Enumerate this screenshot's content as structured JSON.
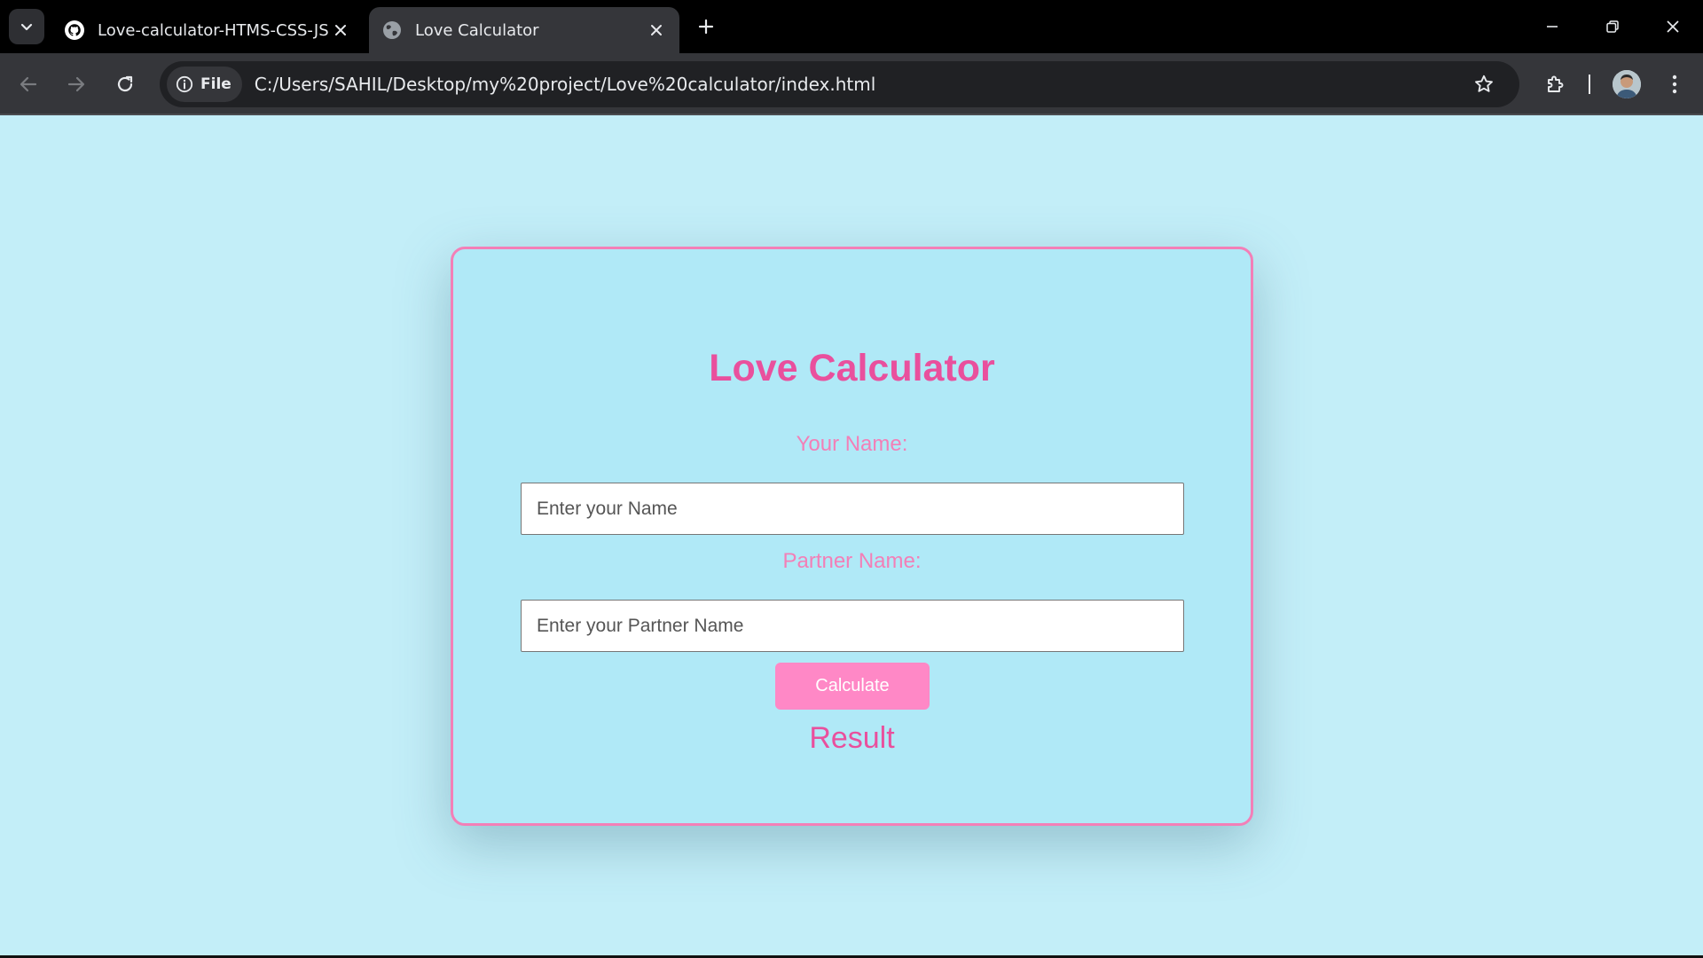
{
  "browser": {
    "tabs": [
      {
        "title": "Love-calculator-HTMS-CSS-JS-",
        "favicon": "github-icon",
        "active": false
      },
      {
        "title": "Love Calculator",
        "favicon": "globe-icon",
        "active": true
      }
    ],
    "site_chip_label": "File",
    "url": "C:/Users/SAHIL/Desktop/my%20project/Love%20calculator/index.html"
  },
  "page": {
    "title": "Love Calculator",
    "your_name_label": "Your Name:",
    "your_name_placeholder": "Enter your Name",
    "partner_name_label": "Partner Name:",
    "partner_name_placeholder": "Enter your Partner Name",
    "calculate_label": "Calculate",
    "result_text": "Result"
  },
  "colors": {
    "background": "#c3eef8",
    "card": "#b0e9f7",
    "accent_pink": "#e9509d",
    "label_pink": "#f37fb7",
    "button_pink": "#ff88c6"
  }
}
